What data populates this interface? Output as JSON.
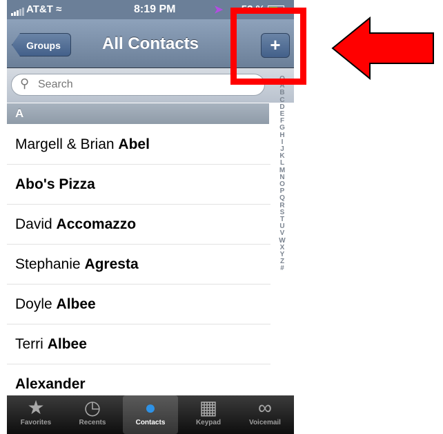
{
  "status": {
    "carrier": "AT&T",
    "time": "8:19 PM",
    "battery": "53 %"
  },
  "nav": {
    "back_label": "Groups",
    "title": "All Contacts",
    "add_label": "+"
  },
  "search": {
    "placeholder": "Search"
  },
  "section": {
    "letter": "A"
  },
  "contacts": [
    {
      "first": "Margell & Brian",
      "last": "Abel"
    },
    {
      "first": "",
      "last": "Abo's Pizza"
    },
    {
      "first": "David",
      "last": "Accomazzo"
    },
    {
      "first": "Stephanie",
      "last": "Agresta"
    },
    {
      "first": "Doyle",
      "last": "Albee"
    },
    {
      "first": "Terri",
      "last": "Albee"
    },
    {
      "first": "",
      "last": "Alexander"
    }
  ],
  "index_letters": [
    "Q",
    "A",
    "B",
    "C",
    "D",
    "E",
    "F",
    "G",
    "H",
    "I",
    "J",
    "K",
    "L",
    "M",
    "N",
    "O",
    "P",
    "Q",
    "R",
    "S",
    "T",
    "U",
    "V",
    "W",
    "X",
    "Y",
    "Z",
    "#"
  ],
  "tabs": [
    {
      "label": "Favorites",
      "icon": "star-icon"
    },
    {
      "label": "Recents",
      "icon": "clock-icon"
    },
    {
      "label": "Contacts",
      "icon": "person-icon"
    },
    {
      "label": "Keypad",
      "icon": "keypad-icon"
    },
    {
      "label": "Voicemail",
      "icon": "voicemail-icon"
    }
  ],
  "colors": {
    "nav": "#6b7f98",
    "annotation": "#ff0000",
    "active_tab_icon": "#2e92e6"
  }
}
